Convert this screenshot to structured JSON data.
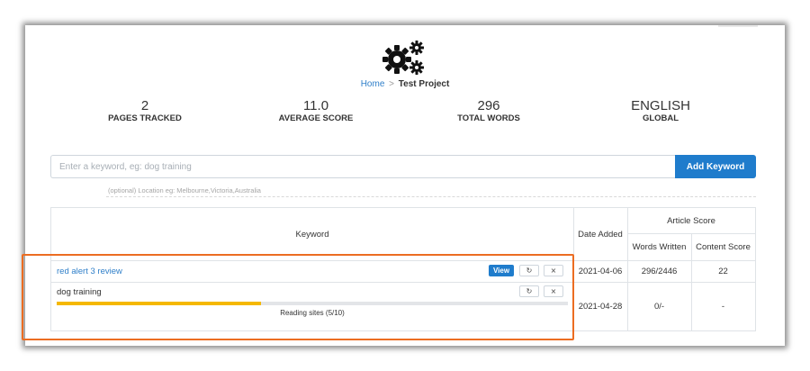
{
  "breadcrumb": {
    "home": "Home",
    "separator": ">",
    "current": "Test Project"
  },
  "stats": [
    {
      "value": "2",
      "label": "PAGES TRACKED"
    },
    {
      "value": "11.0",
      "label": "AVERAGE SCORE"
    },
    {
      "value": "296",
      "label": "TOTAL WORDS"
    },
    {
      "value": "ENGLISH",
      "label": "GLOBAL"
    }
  ],
  "keyword_form": {
    "placeholder": "Enter a keyword, eg: dog training",
    "location_placeholder": "(optional) Location eg: Melbourne,Victoria,Australia",
    "add_label": "Add Keyword"
  },
  "table": {
    "headers": {
      "keyword": "Keyword",
      "date_added": "Date Added",
      "article_score": "Article Score",
      "words_written": "Words Written",
      "content_score": "Content Score"
    },
    "rows": [
      {
        "keyword": "red alert 3 review",
        "view_label": "View",
        "date": "2021-04-06",
        "words": "296/2446",
        "score": "22"
      },
      {
        "keyword": "dog training",
        "date": "2021-04-28",
        "words": "0/-",
        "score": "-",
        "progress": 0.4,
        "status": "Reading sites (5/10)"
      }
    ]
  },
  "icons": {
    "refresh": "↻",
    "close": "×"
  },
  "colors": {
    "accent": "#1f7ccc",
    "progress": "#f5b800",
    "highlight": "#ec6d22"
  }
}
